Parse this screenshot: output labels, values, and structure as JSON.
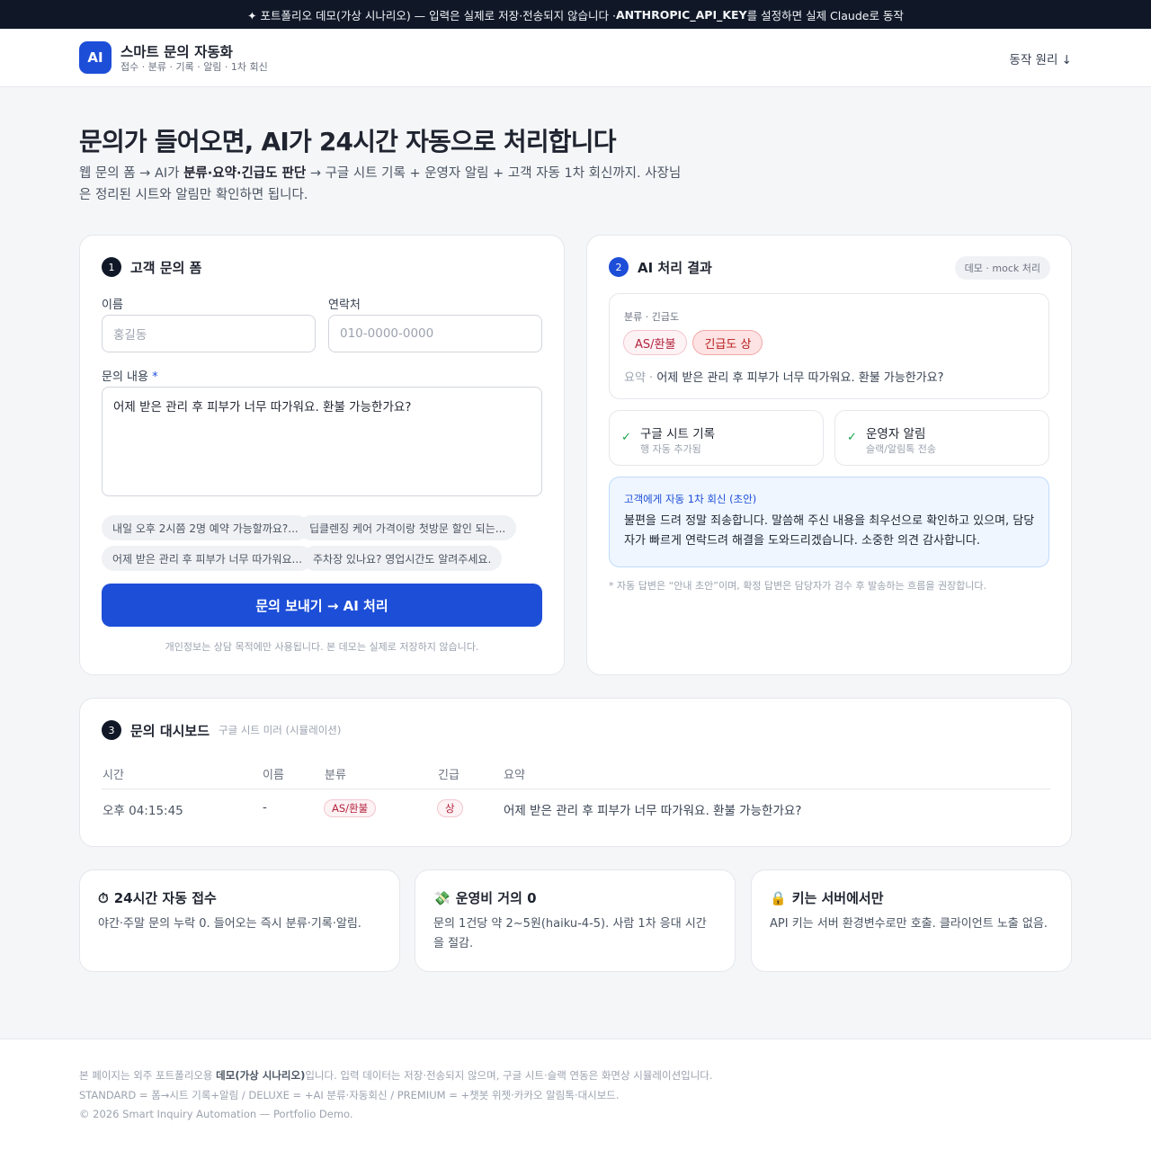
{
  "banner": {
    "prefix": "✦ 포트폴리오 데모(가상 시나리오) — 입력은 실제로 저장·전송되지 않습니다 · ",
    "key": "ANTHROPIC_API_KEY",
    "suffix": "를 설정하면 실제 Claude로 동작"
  },
  "header": {
    "logo": "AI",
    "title": "스마트 문의 자동화",
    "subtitle": "접수 · 분류 · 기록 · 알림 · 1차 회신",
    "how_link": "동작 원리 ↓"
  },
  "hero": {
    "title": "문의가 들어오면, AI가 24시간 자동으로 처리합니다",
    "desc_1": "웹 문의 폼 → AI가 ",
    "desc_bold": "분류·요약·긴급도 판단",
    "desc_2": " → 구글 시트 기록 + 운영자 알림 + 고객 자동 1차 회신까지. 사장님은 정리된 시트와 알림만 확인하면 됩니다."
  },
  "form": {
    "step": "1",
    "title": "고객 문의 폼",
    "name_label": "이름",
    "name_placeholder": "홍길동",
    "phone_label": "연락처",
    "phone_placeholder": "010-0000-0000",
    "content_label": "문의 내용",
    "content_required": "*",
    "content_value": "어제 받은 관리 후 피부가 너무 따가워요. 환불 가능한가요?",
    "samples": [
      "내일 오후 2시쯤 2명 예약 가능할까요?...",
      "딥클렌징 케어 가격이랑 첫방문 할인 되는...",
      "어제 받은 관리 후 피부가 너무 따가워요...",
      "주차장 있나요? 영업시간도 알려주세요."
    ],
    "submit": "문의 보내기 → AI 처리",
    "privacy": "개인정보는 상담 목적에만 사용됩니다. 본 데모는 실제로 저장하지 않습니다."
  },
  "result": {
    "step": "2",
    "title": "AI 처리 결과",
    "badge": "데모 · mock 처리",
    "class_label": "분류 · 긴급도",
    "category": "AS/환불",
    "urgency": "긴급도 상",
    "summary_label": "요약 · ",
    "summary": "어제 받은 관리 후 피부가 너무 따가워요. 환불 가능한가요?",
    "sheet_title": "구글 시트 기록",
    "sheet_sub": "행 자동 추가됨",
    "alert_title": "운영자 알림",
    "alert_sub": "슬랙/알림톡 전송",
    "reply_label": "고객에게 자동 1차 회신 (초안)",
    "reply_text": "불편을 드려 정말 죄송합니다. 말씀해 주신 내용을 최우선으로 확인하고 있으며, 담당자가 빠르게 연락드려 해결을 도와드리겠습니다. 소중한 의견 감사합니다.",
    "footnote": "* 자동 답변은 “안내 초안”이며, 확정 답변은 담당자가 검수 후 발송하는 흐름을 권장합니다."
  },
  "dashboard": {
    "step": "3",
    "title": "문의 대시보드",
    "subtitle": "구글 시트 미러 (시뮬레이션)",
    "columns": [
      "시간",
      "이름",
      "분류",
      "긴급",
      "요약"
    ],
    "rows": [
      {
        "time": "오후 04:15:45",
        "name": "-",
        "category": "AS/환불",
        "urgency": "상",
        "summary": "어제 받은 관리 후 피부가 너무 따가워요. 환불 가능한가요?"
      }
    ]
  },
  "features": [
    {
      "icon": "⏱",
      "title": "24시간 자동 접수",
      "desc": "야간·주말 문의 누락 0. 들어오는 즉시 분류·기록·알림."
    },
    {
      "icon": "💸",
      "title": "운영비 거의 0",
      "desc": "문의 1건당 약 2~5원(haiku-4-5). 사람 1차 응대 시간을 절감."
    },
    {
      "icon": "🔒",
      "title": "키는 서버에서만",
      "desc": "API 키는 서버 환경변수로만 호출. 클라이언트 노출 없음."
    }
  ],
  "footer": {
    "line1_a": "본 페이지는 외주 포트폴리오용 ",
    "line1_b": "데모(가상 시나리오)",
    "line1_c": "입니다. 입력 데이터는 저장·전송되지 않으며, 구글 시트·슬랙 연동은 화면상 시뮬레이션입니다.",
    "line2": "STANDARD = 폼→시트 기록+알림 / DELUXE = +AI 분류·자동회신 / PREMIUM = +챗봇 위젯·카카오 알림톡·대시보드.",
    "line3": "© 2026 Smart Inquiry Automation — Portfolio Demo."
  }
}
